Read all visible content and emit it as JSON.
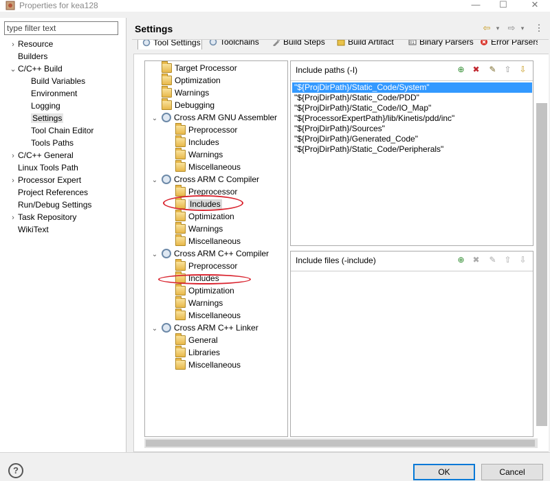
{
  "window": {
    "title": "Properties for kea128",
    "minimize": "—",
    "maximize": "☐",
    "close": "✕"
  },
  "filter": {
    "placeholder": "type filter text"
  },
  "nav": [
    {
      "label": "Resource",
      "expander": "›"
    },
    {
      "label": "Builders",
      "expander": ""
    },
    {
      "label": "C/C++ Build",
      "expander": "⌄"
    },
    {
      "label": "Build Variables",
      "expander": ""
    },
    {
      "label": "Environment",
      "expander": ""
    },
    {
      "label": "Logging",
      "expander": ""
    },
    {
      "label": "Settings",
      "expander": ""
    },
    {
      "label": "Tool Chain Editor",
      "expander": ""
    },
    {
      "label": "Tools Paths",
      "expander": ""
    },
    {
      "label": "C/C++ General",
      "expander": "›"
    },
    {
      "label": "Linux Tools Path",
      "expander": ""
    },
    {
      "label": "Processor Expert",
      "expander": "›"
    },
    {
      "label": "Project References",
      "expander": ""
    },
    {
      "label": "Run/Debug Settings",
      "expander": ""
    },
    {
      "label": "Task Repository",
      "expander": "›"
    },
    {
      "label": "WikiText",
      "expander": ""
    }
  ],
  "header": {
    "title": "Settings",
    "back": "⇦",
    "forward": "⇨",
    "menu": "⋮"
  },
  "tabs": [
    "Tool Settings",
    "Toolchains",
    "Build Steps",
    "Build Artifact",
    "Binary Parsers",
    "Error Parsers"
  ],
  "tree": [
    {
      "label": "Target Processor",
      "icon": "folder",
      "expander": ""
    },
    {
      "label": "Optimization",
      "icon": "folder",
      "expander": ""
    },
    {
      "label": "Warnings",
      "icon": "folder",
      "expander": ""
    },
    {
      "label": "Debugging",
      "icon": "folder",
      "expander": ""
    },
    {
      "label": "Cross ARM GNU Assembler",
      "icon": "gear",
      "expander": "⌄"
    },
    {
      "label": "Preprocessor",
      "icon": "folder",
      "expander": ""
    },
    {
      "label": "Includes",
      "icon": "folder",
      "expander": ""
    },
    {
      "label": "Warnings",
      "icon": "folder",
      "expander": ""
    },
    {
      "label": "Miscellaneous",
      "icon": "folder",
      "expander": ""
    },
    {
      "label": "Cross ARM C Compiler",
      "icon": "gear",
      "expander": "⌄"
    },
    {
      "label": "Preprocessor",
      "icon": "folder",
      "expander": ""
    },
    {
      "label": "Includes",
      "icon": "folder",
      "expander": ""
    },
    {
      "label": "Optimization",
      "icon": "folder",
      "expander": ""
    },
    {
      "label": "Warnings",
      "icon": "folder",
      "expander": ""
    },
    {
      "label": "Miscellaneous",
      "icon": "folder",
      "expander": ""
    },
    {
      "label": "Cross ARM C++ Compiler",
      "icon": "gear",
      "expander": "⌄"
    },
    {
      "label": "Preprocessor",
      "icon": "folder",
      "expander": ""
    },
    {
      "label": "Includes",
      "icon": "folder",
      "expander": ""
    },
    {
      "label": "Optimization",
      "icon": "folder",
      "expander": ""
    },
    {
      "label": "Warnings",
      "icon": "folder",
      "expander": ""
    },
    {
      "label": "Miscellaneous",
      "icon": "folder",
      "expander": ""
    },
    {
      "label": "Cross ARM C++ Linker",
      "icon": "gear",
      "expander": "⌄"
    },
    {
      "label": "General",
      "icon": "folder",
      "expander": ""
    },
    {
      "label": "Libraries",
      "icon": "folder",
      "expander": ""
    },
    {
      "label": "Miscellaneous",
      "icon": "folder",
      "expander": ""
    }
  ],
  "include_paths": {
    "title": "Include paths (-I)",
    "items": [
      "\"${ProjDirPath}/Static_Code/System\"",
      "\"${ProjDirPath}/Static_Code/PDD\"",
      "\"${ProjDirPath}/Static_Code/IO_Map\"",
      "\"${ProcessorExpertPath}/lib/Kinetis/pdd/inc\"",
      "\"${ProjDirPath}/Sources\"",
      "\"${ProjDirPath}/Generated_Code\"",
      "\"${ProjDirPath}/Static_Code/Peripherals\""
    ]
  },
  "include_files": {
    "title": "Include files (-include)",
    "items": []
  },
  "buttons": {
    "ok": "OK",
    "cancel": "Cancel",
    "help": "?"
  },
  "colors": {
    "selection": "#3399ff",
    "annotation": "#d9232e"
  }
}
